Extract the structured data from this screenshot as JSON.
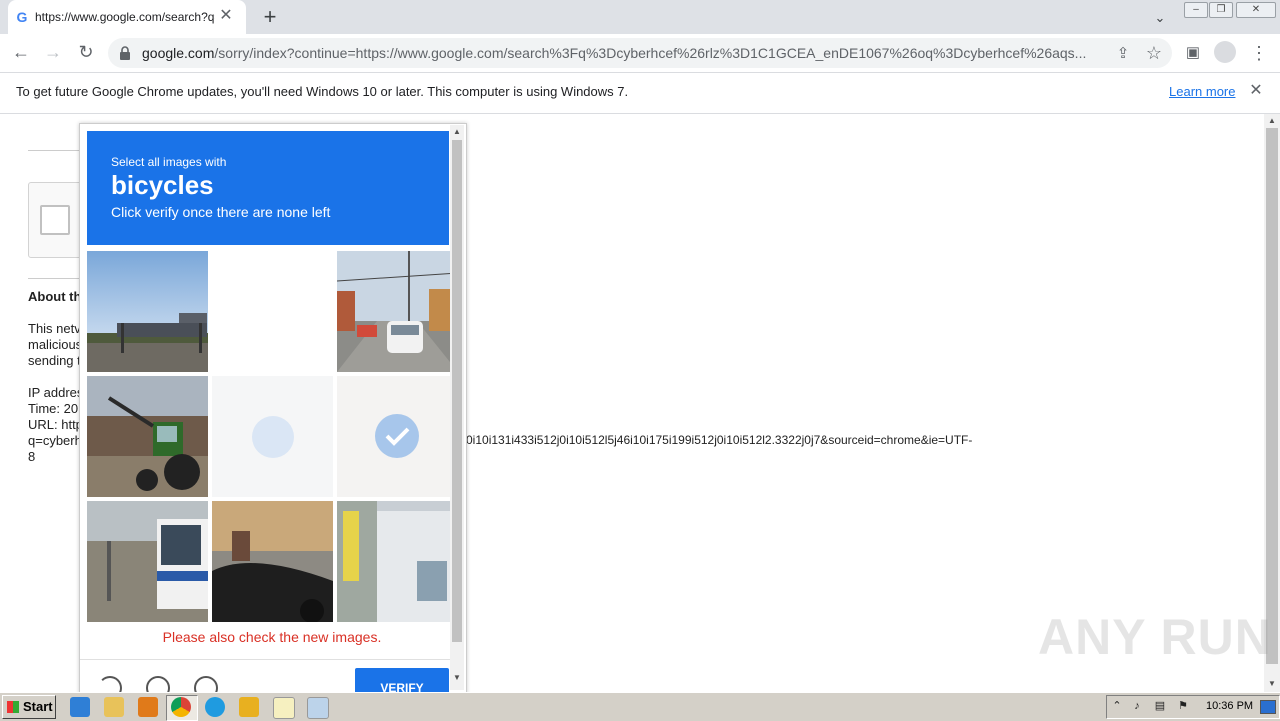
{
  "tab": {
    "title": "https://www.google.com/search?q=",
    "favicon": "G"
  },
  "toolbar": {
    "url_host": "google.com",
    "url_rest": "/sorry/index?continue=https://www.google.com/search%3Fq%3Dcyberhcef%26rlz%3D1C1GCEA_enDE1067%26oq%3Dcyberhcef%26aqs..."
  },
  "infobar": {
    "message": "To get future Google Chrome updates, you'll need Windows 10 or later. This computer is using Windows 7.",
    "learn_more": "Learn more"
  },
  "page": {
    "about_title": "About th",
    "lines1": [
      "This netv",
      "malicious",
      "sending t"
    ],
    "lines2": [
      "IP addres",
      "Time: 20:",
      "URL: http",
      "q=cyberh",
      "8"
    ],
    "url_tail": "0i10i131i433i512j0i10i512l5j46i10i175i199i512j0i10i512l2.3322j0j7&sourceid=chrome&ie=UTF-"
  },
  "challenge": {
    "instruction": "Select all images with",
    "keyword": "bicycles",
    "subtext": "Click verify once there are none left",
    "error": "Please also check the new images.",
    "verify_label": "VERIFY",
    "tiles": [
      {
        "name": "highway-sign",
        "state": "image"
      },
      {
        "name": "blank",
        "state": "loading"
      },
      {
        "name": "street-cars",
        "state": "image"
      },
      {
        "name": "tractor",
        "state": "image"
      },
      {
        "name": "faded-selected",
        "state": "selected"
      },
      {
        "name": "faded-selected",
        "state": "selected"
      },
      {
        "name": "bus",
        "state": "image"
      },
      {
        "name": "parked-car",
        "state": "image"
      },
      {
        "name": "building-banner",
        "state": "image"
      }
    ]
  },
  "watermark": "ANY RUN",
  "taskbar": {
    "start": "Start",
    "clock": "10:36 PM"
  },
  "colors": {
    "accent": "#1a73e8",
    "error": "#d93025",
    "tab_strip": "#dee1e6",
    "taskbar": "#d4d0c8"
  }
}
